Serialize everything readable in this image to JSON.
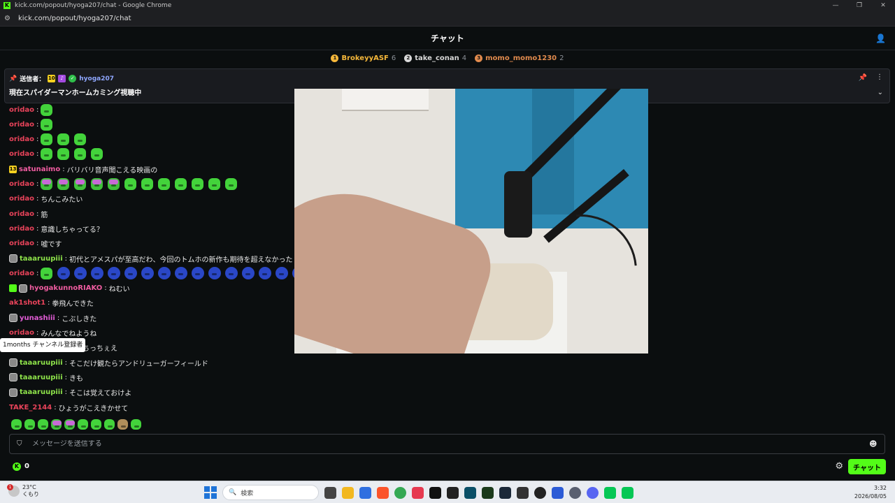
{
  "browser": {
    "window_title": "kick.com/popout/hyoga207/chat - Google Chrome",
    "url": "kick.com/popout/hyoga207/chat"
  },
  "chat_header": {
    "title": "チャット"
  },
  "leaderboard": [
    {
      "rank": "1",
      "name": "BrokeyyASF",
      "count": "6",
      "color": "#f5b73a"
    },
    {
      "rank": "2",
      "name": "take_conan",
      "count": "4",
      "color": "#d9d9d9"
    },
    {
      "rank": "3",
      "name": "momo_momo1230",
      "count": "2",
      "color": "#e08a4d"
    }
  ],
  "pinned": {
    "sender_label": "送信者：",
    "badge_months": "10",
    "sender_name": "hyoga207",
    "message": "現在スパイダーマンホームカミング視聴中"
  },
  "messages": [
    {
      "user": "oridao",
      "color": "#e8435a",
      "text": "",
      "emotes": [
        "green"
      ]
    },
    {
      "user": "oridao",
      "color": "#e8435a",
      "text": "",
      "emotes": [
        "green"
      ]
    },
    {
      "user": "oridao",
      "color": "#e8435a",
      "text": "",
      "emotes": [
        "green",
        "green",
        "green"
      ]
    },
    {
      "user": "oridao",
      "color": "#e8435a",
      "text": "",
      "emotes": [
        "green",
        "green",
        "green",
        "green"
      ]
    },
    {
      "user": "satunaimo",
      "color": "#ef5ca0",
      "text": "バリバリ音声聞こえる映画の",
      "badge": "13"
    },
    {
      "user": "oridao",
      "color": "#e8435a",
      "text": "",
      "emotes": [
        "pink",
        "pink",
        "pink",
        "pink",
        "pink",
        "green",
        "green",
        "green",
        "green",
        "green",
        "green",
        "green"
      ]
    },
    {
      "user": "oridao",
      "color": "#e8435a",
      "text": "ちんこみたい"
    },
    {
      "user": "oridao",
      "color": "#e8435a",
      "text": "筋"
    },
    {
      "user": "oridao",
      "color": "#e8435a",
      "text": "意識しちゃってる？"
    },
    {
      "user": "oridao",
      "color": "#e8435a",
      "text": "嘘です"
    },
    {
      "user": "taaaruupiii",
      "color": "#8ee34a",
      "text": "初代とアメスパが至高だわ、今回のトムホの新作も期待を超えなかった",
      "avatar": true
    },
    {
      "user": "oridao",
      "color": "#e8435a",
      "text": "",
      "emotes": [
        "green",
        "blue",
        "blue",
        "blue",
        "blue",
        "blue",
        "blue",
        "blue",
        "blue",
        "blue",
        "blue",
        "blue",
        "blue",
        "blue",
        "blue",
        "blue",
        "blue",
        "blue"
      ]
    },
    {
      "user": "hyogakunnoRIAKO",
      "color": "#ef5ca0",
      "text": "ねむい",
      "avatar": true,
      "gift": true
    },
    {
      "user": "ak1shot1",
      "color": "#e8435a",
      "text": "拳飛んできた"
    },
    {
      "user": "yunashiii",
      "color": "#e25cd6",
      "text": "こぶしきた",
      "avatar": true
    },
    {
      "user": "oridao",
      "color": "#e8435a",
      "text": "みんなでねようね"
    },
    {
      "user": "",
      "color": "#e8435a",
      "text": "ちっちぇえ"
    },
    {
      "user": "taaaruupiii",
      "color": "#8ee34a",
      "text": "そこだけ観たらアンドリューガーフィールド",
      "avatar": true
    },
    {
      "user": "taaaruupiii",
      "color": "#8ee34a",
      "text": "きも",
      "avatar": true
    },
    {
      "user": "taaaruupiii",
      "color": "#8ee34a",
      "text": "そこは覚えておけよ",
      "avatar": true
    },
    {
      "user": "TAKE_2144",
      "color": "#e8435a",
      "text": "ひょうがこえきかせて"
    }
  ],
  "tooltip": {
    "text": "1months チャンネル登録者"
  },
  "input": {
    "placeholder": "メッセージを送信する"
  },
  "footer": {
    "points": "0",
    "chat_button": "チャット"
  },
  "taskbar": {
    "weather_temp": "23°C",
    "weather_desc": "くもり",
    "weather_badge": "1",
    "search_label": "検索",
    "time": "3:32",
    "date": "2026/08/05"
  },
  "colors": {
    "brand_green": "#53fc18",
    "background": "#0b0e0f"
  }
}
